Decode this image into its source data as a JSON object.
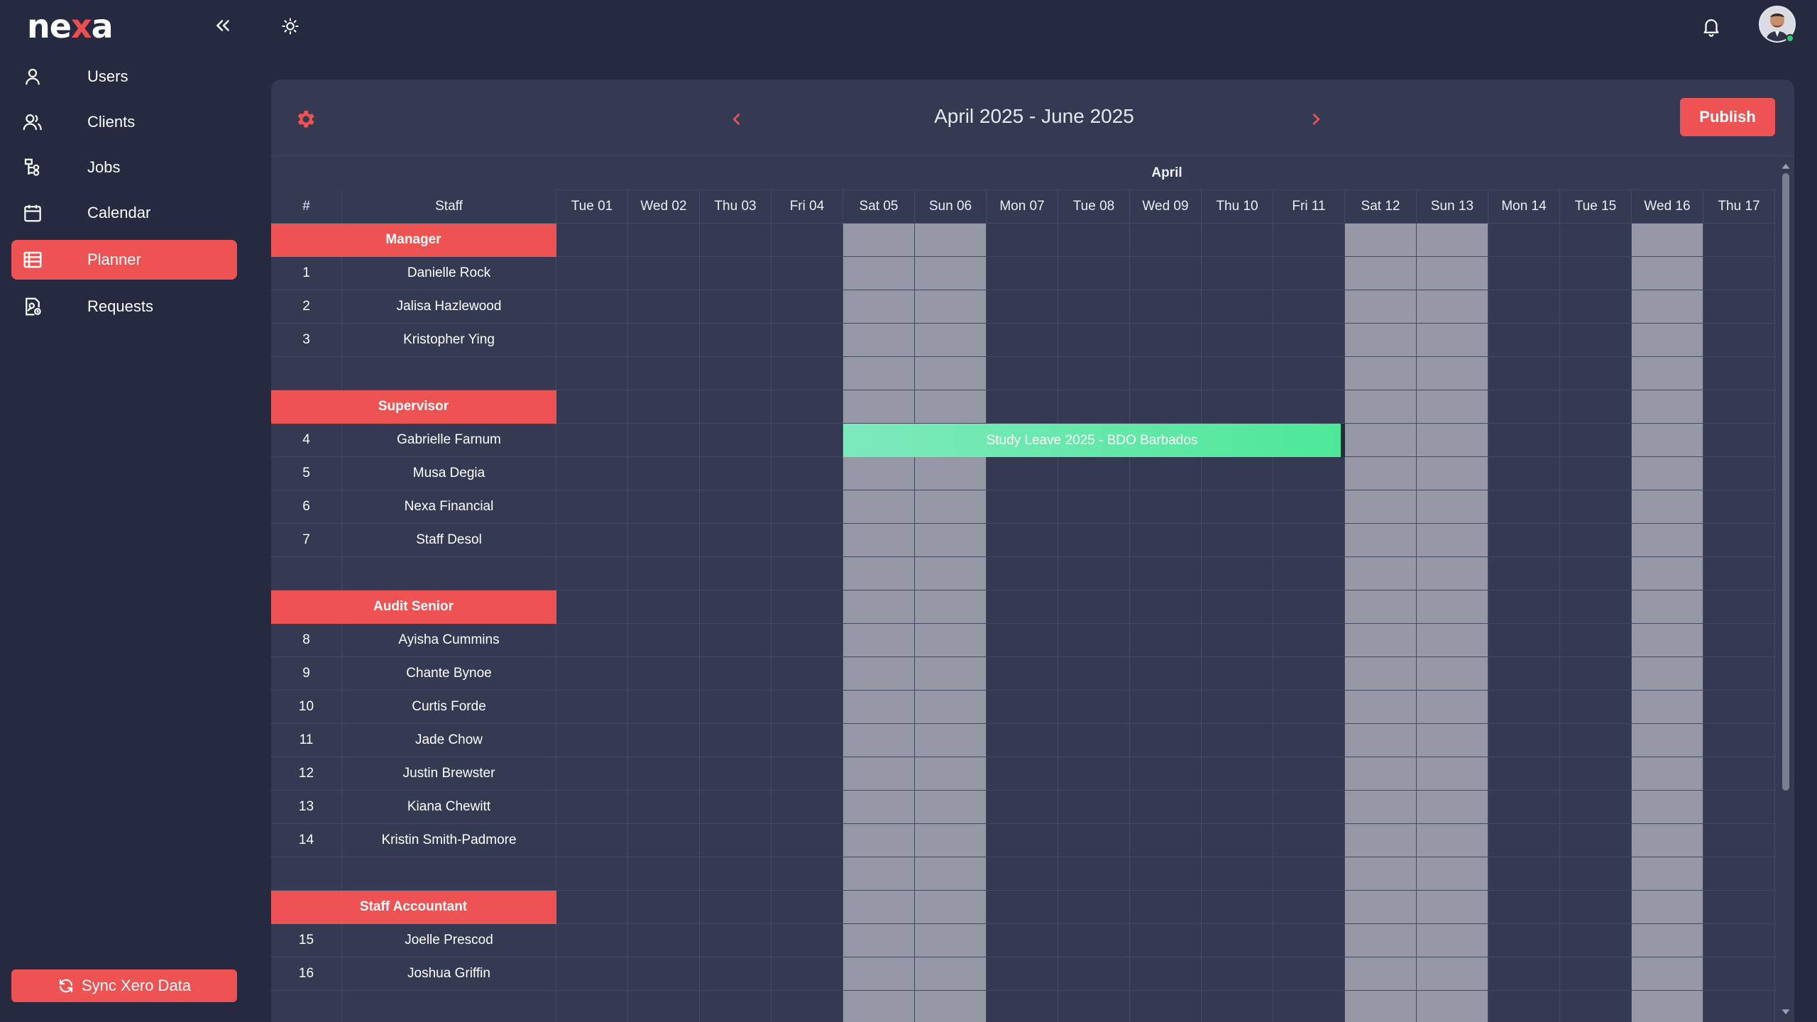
{
  "brand": {
    "logo_prefix": "ne",
    "logo_x": "x",
    "logo_suffix": "a"
  },
  "sidebar": {
    "items": [
      {
        "label": "Users",
        "icon": "user-icon"
      },
      {
        "label": "Clients",
        "icon": "users-icon"
      },
      {
        "label": "Jobs",
        "icon": "jobs-icon"
      },
      {
        "label": "Calendar",
        "icon": "calendar-icon"
      },
      {
        "label": "Planner",
        "icon": "table-icon",
        "active": true
      },
      {
        "label": "Requests",
        "icon": "requests-icon"
      }
    ],
    "sync_label": "Sync Xero Data"
  },
  "planner": {
    "range_title": "April 2025 - June 2025",
    "publish_label": "Publish",
    "month": "April",
    "col_num": "#",
    "col_staff": "Staff",
    "days": [
      {
        "label": "Tue 01",
        "weekend": false
      },
      {
        "label": "Wed 02",
        "weekend": false
      },
      {
        "label": "Thu 03",
        "weekend": false
      },
      {
        "label": "Fri 04",
        "weekend": false
      },
      {
        "label": "Sat 05",
        "weekend": true
      },
      {
        "label": "Sun 06",
        "weekend": true
      },
      {
        "label": "Mon 07",
        "weekend": false
      },
      {
        "label": "Tue 08",
        "weekend": false
      },
      {
        "label": "Wed 09",
        "weekend": false
      },
      {
        "label": "Thu 10",
        "weekend": false
      },
      {
        "label": "Fri 11",
        "weekend": false
      },
      {
        "label": "Sat 12",
        "weekend": true
      },
      {
        "label": "Sun 13",
        "weekend": true
      },
      {
        "label": "Mon 14",
        "weekend": false
      },
      {
        "label": "Tue 15",
        "weekend": false
      },
      {
        "label": "Wed 16",
        "weekend": true
      },
      {
        "label": "Thu 17",
        "weekend": false
      }
    ],
    "rows": [
      {
        "type": "group",
        "label": "Manager"
      },
      {
        "type": "staff",
        "num": "1",
        "name": "Danielle Rock"
      },
      {
        "type": "staff",
        "num": "2",
        "name": "Jalisa Hazlewood"
      },
      {
        "type": "staff",
        "num": "3",
        "name": "Kristopher Ying"
      },
      {
        "type": "spacer"
      },
      {
        "type": "group",
        "label": "Supervisor"
      },
      {
        "type": "staff",
        "num": "4",
        "name": "Gabrielle Farnum"
      },
      {
        "type": "staff",
        "num": "5",
        "name": "Musa Degia"
      },
      {
        "type": "staff",
        "num": "6",
        "name": "Nexa Financial"
      },
      {
        "type": "staff",
        "num": "7",
        "name": "Staff Desol"
      },
      {
        "type": "spacer"
      },
      {
        "type": "group",
        "label": "Audit Senior"
      },
      {
        "type": "staff",
        "num": "8",
        "name": "Ayisha Cummins"
      },
      {
        "type": "staff",
        "num": "9",
        "name": "Chante Bynoe"
      },
      {
        "type": "staff",
        "num": "10",
        "name": "Curtis Forde"
      },
      {
        "type": "staff",
        "num": "11",
        "name": "Jade Chow"
      },
      {
        "type": "staff",
        "num": "12",
        "name": "Justin Brewster"
      },
      {
        "type": "staff",
        "num": "13",
        "name": "Kiana Chewitt"
      },
      {
        "type": "staff",
        "num": "14",
        "name": "Kristin Smith-Padmore"
      },
      {
        "type": "spacer"
      },
      {
        "type": "group",
        "label": "Staff Accountant"
      },
      {
        "type": "staff",
        "num": "15",
        "name": "Joelle Prescod"
      },
      {
        "type": "staff",
        "num": "16",
        "name": "Joshua Griffin"
      },
      {
        "type": "spacer"
      }
    ],
    "leave": {
      "label": "Study Leave 2025 - BDO Barbados",
      "staff": "Gabrielle Farnum",
      "from": "Sat 05",
      "to": "Fri 11"
    }
  },
  "colors": {
    "accent": "#ef5253",
    "bg": "#262a40",
    "panel": "#353a53",
    "weekend": "#9698a6",
    "leave": "#4de897"
  }
}
